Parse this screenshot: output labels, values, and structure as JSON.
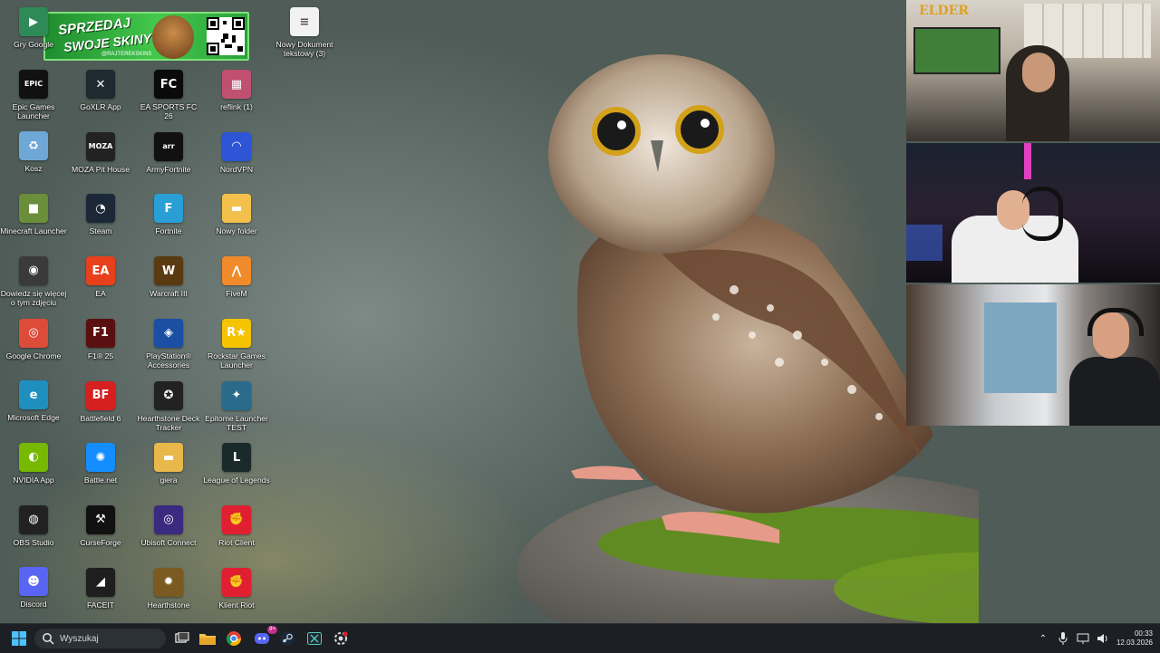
{
  "desktop": {
    "icons": [
      {
        "label": "Gry Google",
        "icon": "google-play-games-icon",
        "glyph": "▶",
        "bg": "#2e8b57"
      },
      {
        "label": "Epic Games Launcher",
        "icon": "epic-games-icon",
        "glyph": "EPIC",
        "bg": "#111111"
      },
      {
        "label": "Kosz",
        "icon": "recycle-bin-icon",
        "glyph": "♻",
        "bg": "#6fa8d6"
      },
      {
        "label": "Minecraft Launcher",
        "icon": "minecraft-icon",
        "glyph": "■",
        "bg": "#6b8e3a"
      },
      {
        "label": "Dowiedz się więcej o tym zdjęciu",
        "icon": "spotlight-icon",
        "glyph": "◉",
        "bg": "#3a3a3a"
      },
      {
        "label": "Google Chrome",
        "icon": "chrome-icon",
        "glyph": "◎",
        "bg": "#dd4b39"
      },
      {
        "label": "Microsoft Edge",
        "icon": "edge-icon",
        "glyph": "e",
        "bg": "#1f8fbf"
      },
      {
        "label": "NVIDIA App",
        "icon": "nvidia-icon",
        "glyph": "◐",
        "bg": "#76b900"
      },
      {
        "label": "OBS Studio",
        "icon": "obs-icon",
        "glyph": "◍",
        "bg": "#222222"
      },
      {
        "label": "Discord",
        "icon": "discord-icon",
        "glyph": "☻",
        "bg": "#5865f2"
      },
      {
        "label": "GoXLR App",
        "icon": "goxlr-icon",
        "glyph": "✕",
        "bg": "#1e2a30"
      },
      {
        "label": "MOZA Pit House",
        "icon": "moza-icon",
        "glyph": "MOZA",
        "bg": "#222222"
      },
      {
        "label": "Steam",
        "icon": "steam-icon",
        "glyph": "◔",
        "bg": "#1b2838"
      },
      {
        "label": "EA",
        "icon": "ea-icon",
        "glyph": "EA",
        "bg": "#e8401c"
      },
      {
        "label": "F1® 25",
        "icon": "f1-icon",
        "glyph": "F1",
        "bg": "#5a1010"
      },
      {
        "label": "Battlefield 6",
        "icon": "battlefield-icon",
        "glyph": "BF",
        "bg": "#d62020"
      },
      {
        "label": "Battle.net",
        "icon": "battlenet-icon",
        "glyph": "✺",
        "bg": "#148eff"
      },
      {
        "label": "CurseForge",
        "icon": "curseforge-icon",
        "glyph": "⚒",
        "bg": "#111111"
      },
      {
        "label": "FACEIT",
        "icon": "faceit-icon",
        "glyph": "◢",
        "bg": "#1e1e1e"
      },
      {
        "label": "Nowy Dokument tekstowy (3)",
        "icon": "text-document-icon",
        "glyph": "≡",
        "bg": "#f2f2f2"
      },
      {
        "label": "EA SPORTS FC 26",
        "icon": "ea-fc-icon",
        "glyph": "FC",
        "bg": "#0a0a0a"
      },
      {
        "label": "ArmyFortnite",
        "icon": "armyfortnite-icon",
        "glyph": "arr",
        "bg": "#111111"
      },
      {
        "label": "Fortnite",
        "icon": "fortnite-icon",
        "glyph": "F",
        "bg": "#2a9fd6"
      },
      {
        "label": "Warcraft III",
        "icon": "warcraft-icon",
        "glyph": "W",
        "bg": "#5a3a10"
      },
      {
        "label": "PlayStation® Accessories",
        "icon": "playstation-icon",
        "glyph": "◈",
        "bg": "#1a4fa3"
      },
      {
        "label": "Hearthstone Deck Tracker",
        "icon": "hdt-icon",
        "glyph": "✪",
        "bg": "#222222"
      },
      {
        "label": "giera",
        "icon": "folder-icon",
        "glyph": "▬",
        "bg": "#e8b84a"
      },
      {
        "label": "Ubisoft Connect",
        "icon": "ubisoft-icon",
        "glyph": "◎",
        "bg": "#3a2a80"
      },
      {
        "label": "Hearthstone",
        "icon": "hearthstone-icon",
        "glyph": "✹",
        "bg": "#7a5a20"
      },
      {
        "label": "reflink (1)",
        "icon": "reflink-icon",
        "glyph": "▦",
        "bg": "#c05070"
      },
      {
        "label": "NordVPN",
        "icon": "nordvpn-icon",
        "glyph": "◠",
        "bg": "#2d55d6"
      },
      {
        "label": "Nowy folder",
        "icon": "folder-icon",
        "glyph": "▬",
        "bg": "#f3c14b"
      },
      {
        "label": "FiveM",
        "icon": "fivem-icon",
        "glyph": "⋀",
        "bg": "#f08a2a"
      },
      {
        "label": "Rockstar Games Launcher",
        "icon": "rockstar-icon",
        "glyph": "R★",
        "bg": "#f5c400"
      },
      {
        "label": "Epitome Launcher TEST",
        "icon": "epitome-icon",
        "glyph": "✦",
        "bg": "#2a6a8a"
      },
      {
        "label": "League of Legends",
        "icon": "lol-icon",
        "glyph": "L",
        "bg": "#1a2a2a"
      },
      {
        "label": "Riot Client",
        "icon": "riot-icon",
        "glyph": "✊",
        "bg": "#e02030"
      },
      {
        "label": "Klient Riot",
        "icon": "riot-icon",
        "glyph": "✊",
        "bg": "#e02030"
      }
    ]
  },
  "overlay": {
    "promo_line1": "SPRZEDAJ",
    "promo_line2": "SWOJE SKINY",
    "promo_handle": "@RAJTEREKSKINS",
    "brand_tag": "ELDER"
  },
  "taskbar": {
    "search_placeholder": "Wyszukaj",
    "discord_badge": "9+",
    "time": "00:33",
    "date": "12.03.2026"
  },
  "colors": {
    "taskbar_bg": "#1c2024",
    "accent": "#0078d4"
  }
}
